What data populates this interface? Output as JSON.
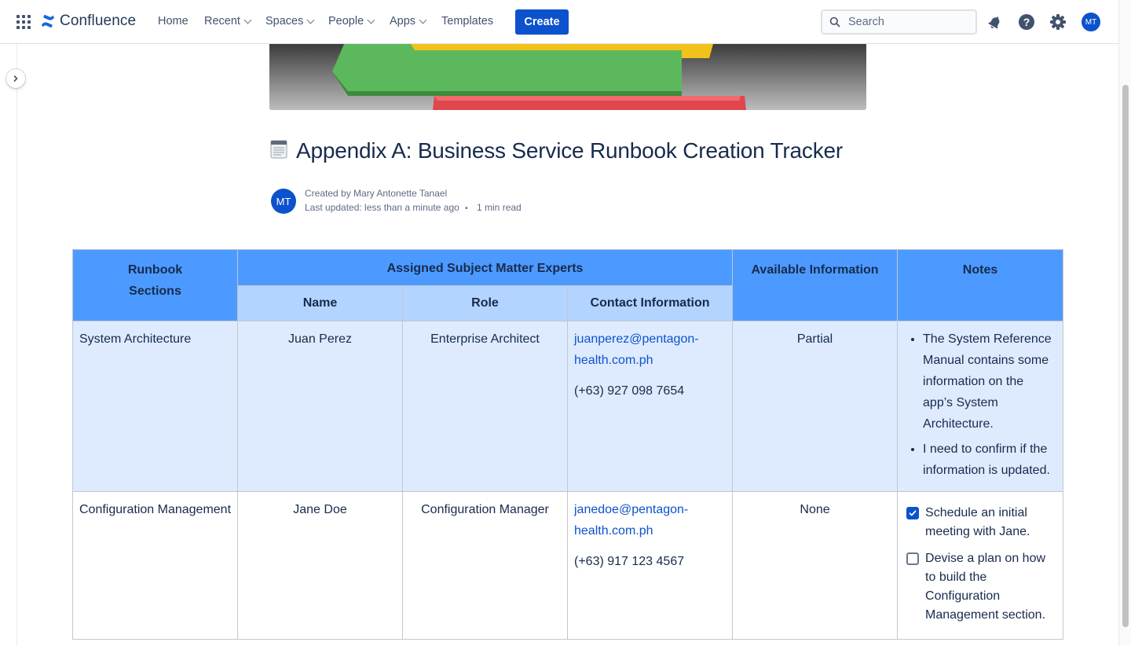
{
  "nav": {
    "logo_text": "Confluence",
    "items": [
      {
        "label": "Home"
      },
      {
        "label": "Recent"
      },
      {
        "label": "Spaces"
      },
      {
        "label": "People"
      },
      {
        "label": "Apps"
      },
      {
        "label": "Templates"
      }
    ],
    "create_label": "Create",
    "search_placeholder": "Search",
    "avatar_initials": "MT"
  },
  "page": {
    "title": "Appendix A: Business Service Runbook Creation Tracker",
    "title_emoji": "🗒️",
    "author_initials": "MT",
    "created_by": "Created by Mary Antonette Tanael",
    "last_updated": "Last updated: less than a minute ago",
    "separator": "•",
    "read_time": "1 min read"
  },
  "table": {
    "headers": {
      "sections": "Runbook Sections",
      "experts": "Assigned Subject Matter Experts",
      "available": "Available Information",
      "notes": "Notes",
      "name": "Name",
      "role": "Role",
      "contact": "Contact Information"
    },
    "rows": [
      {
        "section": "System Architecture",
        "name": "Juan Perez",
        "role": "Enterprise Architect",
        "email": "juanperez@pentagon-health.com.ph",
        "phone": "(+63) 927 098 7654",
        "available": "Partial",
        "notes": [
          "The System Reference Manual contains some information on the app’s System Architecture.",
          "I need to confirm if the information is updated."
        ]
      },
      {
        "section": "Configuration Management",
        "name": "Jane Doe",
        "role": "Configuration Manager",
        "email": "janedoe@pentagon-health.com.ph",
        "phone": "(+63) 917 123 4567",
        "available": "None",
        "tasks": [
          {
            "text": "Schedule an initial meeting with Jane.",
            "checked": true
          },
          {
            "text": "Devise a plan on how to build the Configuration Management section.",
            "checked": false
          }
        ]
      }
    ]
  },
  "colors": {
    "header_dark": "#4c9aff",
    "header_light": "#b3d4ff",
    "row_highlight": "#deebff",
    "brand": "#0c52cc"
  }
}
